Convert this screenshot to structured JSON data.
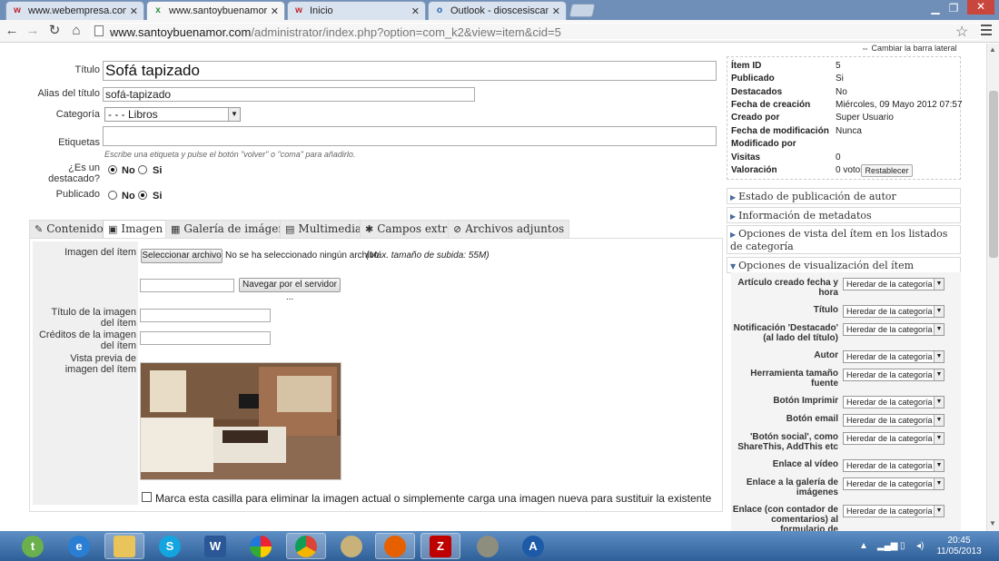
{
  "browser": {
    "tabs": [
      {
        "label": "www.webempresa.com/re",
        "favicon": "w",
        "favicon_color": "#c0202a"
      },
      {
        "label": "www.santoybuenamor.co",
        "favicon": "x",
        "favicon_color": "#2c8a3a"
      },
      {
        "label": "Inicio",
        "favicon": "w",
        "favicon_color": "#c0202a"
      },
      {
        "label": "Outlook - dioscesiscanela",
        "favicon": "o",
        "favicon_color": "#1f5fb5"
      }
    ],
    "close_glyph": "✕",
    "url_domain": "www.santoybuenamor.com",
    "url_path": "/administrator/index.php?option=com_k2&view=item&cid=5"
  },
  "form": {
    "title_label": "Título",
    "title_value": "Sofá tapizado",
    "alias_label": "Alias del título",
    "alias_value": "sofá-tapizado",
    "category_label": "Categoría",
    "category_value": "- - - Libros",
    "tags_label": "Etiquetas",
    "tags_hint": "Escribe una etiqueta y pulse el botón \"volver\" o \"coma\" para añadirlo.",
    "featured_label": "¿Es un destacado?",
    "featured_no": "No",
    "featured_si": "Si",
    "published_label": "Publicado",
    "published_no": "No",
    "published_si": "Si"
  },
  "tabs": [
    {
      "label": "Contenido",
      "icon": "✎"
    },
    {
      "label": "Imagen",
      "icon": "▣"
    },
    {
      "label": "Galería de imágenes",
      "icon": "▦"
    },
    {
      "label": "Multimedia",
      "icon": "▤"
    },
    {
      "label": "Campos extra",
      "icon": "✱"
    },
    {
      "label": "Archivos adjuntos",
      "icon": "⊘"
    }
  ],
  "image": {
    "item_image_label": "Imagen del ítem",
    "choose_file": "Seleccionar archivo",
    "no_file": "No se ha seleccionado ningún archivo",
    "max_size": "(Máx. tamaño de subida: 55M)",
    "browse_server": "Navegar por el servidor ...",
    "caption_label": "Título de la imagen del ítem",
    "credits_label": "Créditos de la imagen del ítem",
    "preview_label": "Vista previa de imagen del ítem",
    "delete_text": "Marca esta casilla para eliminar la imagen actual o simplemente carga una imagen nueva para sustituir la existente"
  },
  "sidebar": {
    "toggle": "Cambiar la barra lateral",
    "info": [
      {
        "k": "Ítem ID",
        "v": "5"
      },
      {
        "k": "Publicado",
        "v": "Si"
      },
      {
        "k": "Destacados",
        "v": "No"
      },
      {
        "k": "Fecha de creación",
        "v": "Miércoles, 09 Mayo 2012 07:57"
      },
      {
        "k": "Creado por",
        "v": "Super Usuario"
      },
      {
        "k": "Fecha de modificación",
        "v": "Nunca"
      },
      {
        "k": "Modificado por",
        "v": ""
      },
      {
        "k": "Visitas",
        "v": "0"
      },
      {
        "k": "Valoración",
        "v": "0 votos"
      }
    ],
    "reset": "Restablecer",
    "sections": [
      "Estado de publicación de autor",
      "Información de metadatos",
      "Opciones de vista del ítem en los listados de categoría",
      "Opciones de visualización del ítem"
    ],
    "option_default": "Heredar de la categoría",
    "options": [
      "Artículo creado fecha y hora",
      "Título",
      "Notificación 'Destacado' (al lado del título)",
      "Autor",
      "Herramienta tamaño fuente",
      "Botón Imprimir",
      "Botón email",
      "'Botón social', como ShareThis, AddThis etc",
      "Enlace al vídeo",
      "Enlace a la galería de imágenes",
      "Enlace (con contador de comentarios) al formulario de"
    ]
  },
  "taskbar": {
    "time": "20:45",
    "date": "11/05/2013"
  }
}
